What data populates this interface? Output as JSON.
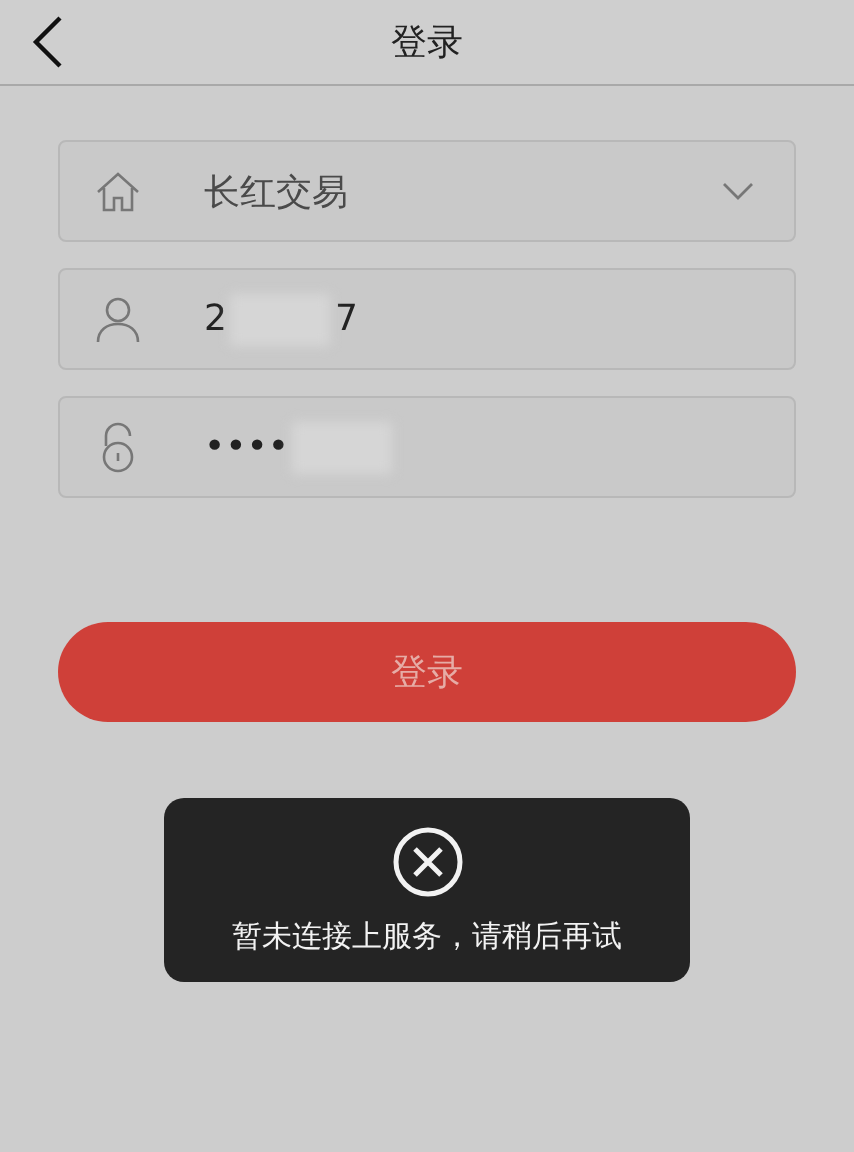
{
  "header": {
    "title": "登录"
  },
  "broker": {
    "value": "长红交易"
  },
  "username": {
    "value_start": "2",
    "value_end": "7"
  },
  "password": {
    "value": "••••"
  },
  "login_button": {
    "label": "登录",
    "disabled": true
  },
  "toast": {
    "message": "暂未连接上服务，请稍后再试"
  }
}
